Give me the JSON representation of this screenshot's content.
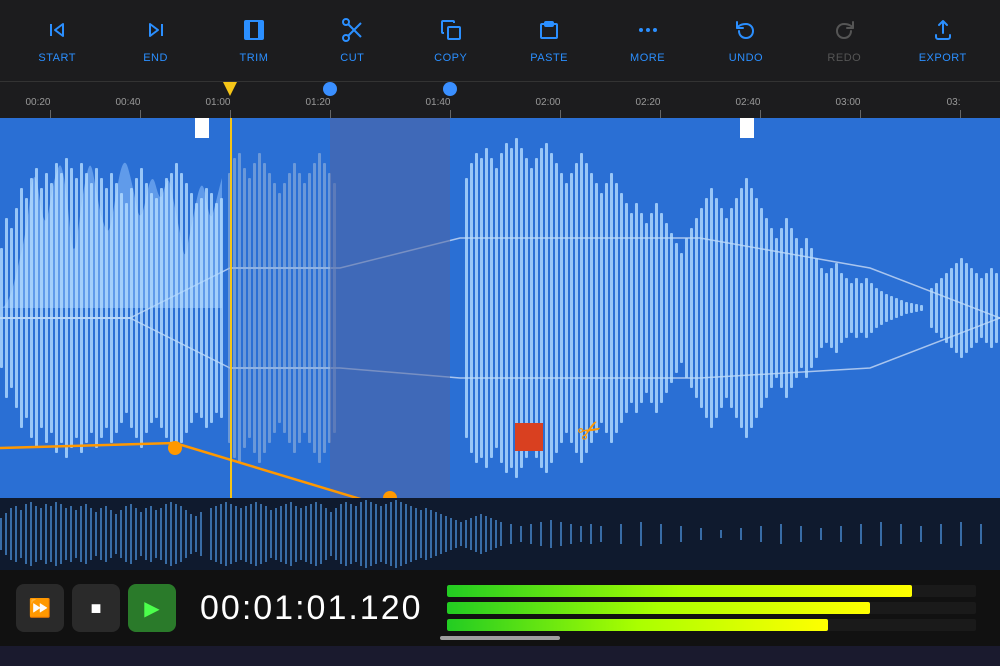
{
  "toolbar": {
    "items": [
      {
        "id": "start",
        "label": "START",
        "icon": "←",
        "disabled": false
      },
      {
        "id": "end",
        "label": "END",
        "icon": "→",
        "disabled": false
      },
      {
        "id": "trim",
        "label": "TRIM",
        "icon": "✂",
        "disabled": false,
        "icon_type": "trim"
      },
      {
        "id": "cut",
        "label": "CUT",
        "icon": "✂",
        "disabled": false
      },
      {
        "id": "copy",
        "label": "COPY",
        "icon": "⧉",
        "disabled": false
      },
      {
        "id": "paste",
        "label": "PASTE",
        "icon": "⬛",
        "disabled": false,
        "icon_type": "paste"
      },
      {
        "id": "more",
        "label": "MORE",
        "icon": "···",
        "disabled": false
      },
      {
        "id": "undo",
        "label": "UNDO",
        "icon": "↩",
        "disabled": false
      },
      {
        "id": "redo",
        "label": "REDO",
        "icon": "↪",
        "disabled": true
      },
      {
        "id": "export",
        "label": "EXPORT",
        "icon": "⬆",
        "disabled": false
      }
    ]
  },
  "ruler": {
    "marks": [
      {
        "label": "00:20",
        "pos_pct": 5
      },
      {
        "label": "00:40",
        "pos_pct": 14
      },
      {
        "label": "01:00",
        "pos_pct": 23
      },
      {
        "label": "01:20",
        "pos_pct": 33
      },
      {
        "label": "01:40",
        "pos_pct": 45
      },
      {
        "label": "02:00",
        "pos_pct": 56
      },
      {
        "label": "02:20",
        "pos_pct": 66
      },
      {
        "label": "02:40",
        "pos_pct": 76
      },
      {
        "label": "03:00",
        "pos_pct": 86
      },
      {
        "label": "03:",
        "pos_pct": 96
      }
    ],
    "playhead_yellow_pct": 23,
    "playhead_blue1_pct": 33,
    "playhead_blue2_pct": 45
  },
  "transport": {
    "timecode": "00:01:01.120",
    "buttons": [
      {
        "id": "fast-forward",
        "icon": "⏩",
        "label": "fast-forward"
      },
      {
        "id": "stop",
        "icon": "■",
        "label": "stop"
      },
      {
        "id": "play",
        "icon": "▶",
        "label": "play",
        "active": true
      }
    ]
  },
  "colors": {
    "background": "#1a1a2e",
    "toolbar_bg": "#1c1c1e",
    "waveform_bg": "#2a6fd4",
    "accent_blue": "#2b8fff",
    "accent_orange": "#ff9800",
    "accent_yellow": "#f5c518",
    "selection_overlay": "rgba(80,100,160,0.55)",
    "mini_waveform_bg": "#0f1a2e",
    "transport_bg": "#111"
  }
}
